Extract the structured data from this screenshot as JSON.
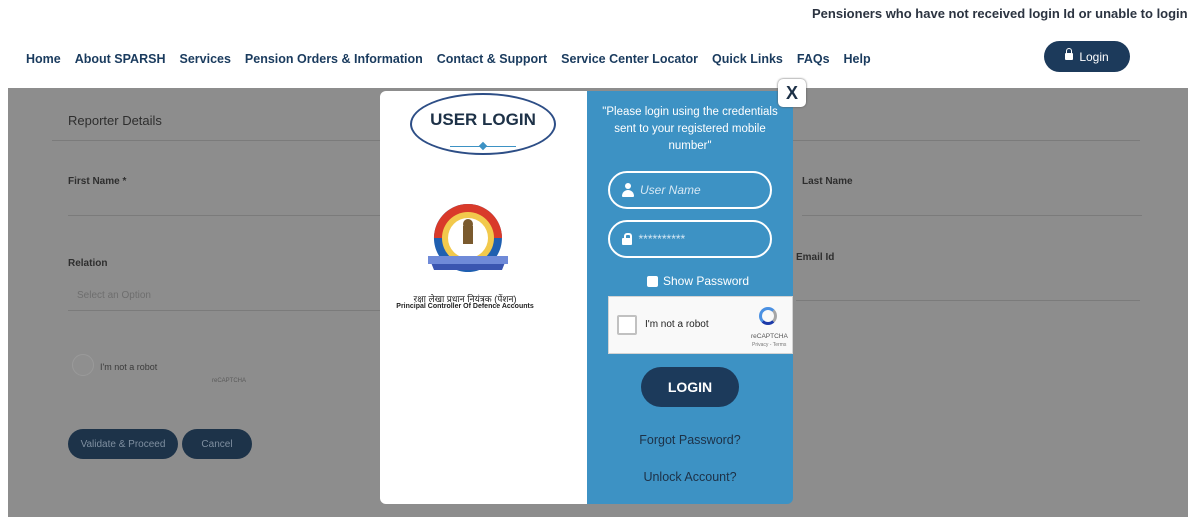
{
  "ticker": "Pensioners who have not received login Id or unable to login please register your gr",
  "nav": {
    "items": [
      "Home",
      "About SPARSH",
      "Services",
      "Pension Orders & Information",
      "Contact & Support",
      "Service Center Locator",
      "Quick Links",
      "FAQs",
      "Help"
    ],
    "login_button": "Login"
  },
  "background_form": {
    "section_title": "Reporter Details",
    "first_name_label": "First Name *",
    "last_name_label": "Last Name",
    "relation_label": "Relation",
    "email_label": "Email Id",
    "relation_placeholder": "Select an Option",
    "robot_label": "I'm not a robot",
    "robot_brand": "reCAPTCHA",
    "validate_button": "Validate & Proceed",
    "cancel_button": "Cancel"
  },
  "modal": {
    "title": "USER LOGIN",
    "close": "X",
    "org_hindi": "रक्षा लेखा प्रधान नियंत्रक (पेंशन)",
    "org_english": "Principal Controller Of Defence Accounts",
    "note": "\"Please login using the credentials sent to your registered mobile number\"",
    "username_placeholder": "User Name",
    "password_placeholder": "**********",
    "show_password": "Show Password",
    "captcha": {
      "label": "I'm not a robot",
      "brand": "reCAPTCHA",
      "terms": "Privacy - Terms"
    },
    "login_button": "LOGIN",
    "forgot_password": "Forgot Password?",
    "unlock_account": "Unlock Account?"
  },
  "colors": {
    "panel_blue": "#3d92c4",
    "navy": "#1c3a5b",
    "overlay_gray": "#8d8d8d",
    "ellipse": "#2d4e86"
  }
}
